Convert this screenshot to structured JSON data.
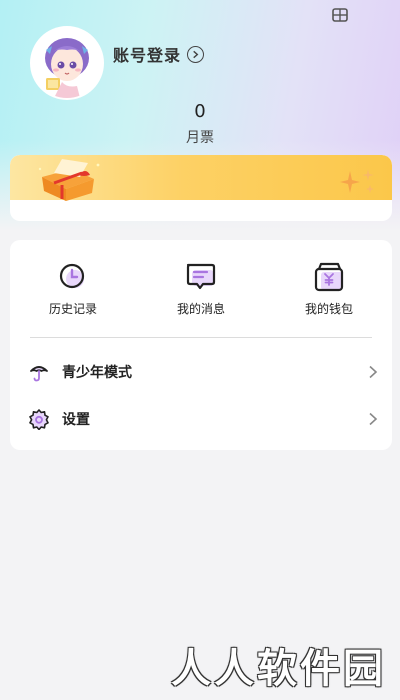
{
  "header": {
    "top_icon": "ticket-icon"
  },
  "profile": {
    "avatar": "anime-avatar",
    "login_label": "账号登录",
    "login_arrow_icon": "chevron-right-circle-icon"
  },
  "stats": {
    "value": "0",
    "label": "月票"
  },
  "banner": {
    "decoration": "gift-box-and-sparkles",
    "colors": {
      "start": "#fde6a2",
      "end": "#fbc74a"
    }
  },
  "shortcuts": [
    {
      "label": "历史记录",
      "icon": "clock-icon"
    },
    {
      "label": "我的消息",
      "icon": "message-icon"
    },
    {
      "label": "我的钱包",
      "icon": "wallet-icon"
    }
  ],
  "menu": [
    {
      "label": "青少年模式",
      "icon": "umbrella-icon"
    },
    {
      "label": "设置",
      "icon": "gear-icon"
    }
  ],
  "watermark": "人人软件园",
  "colors": {
    "accent": "#a975e0",
    "accent_light": "#e8d7fb"
  }
}
